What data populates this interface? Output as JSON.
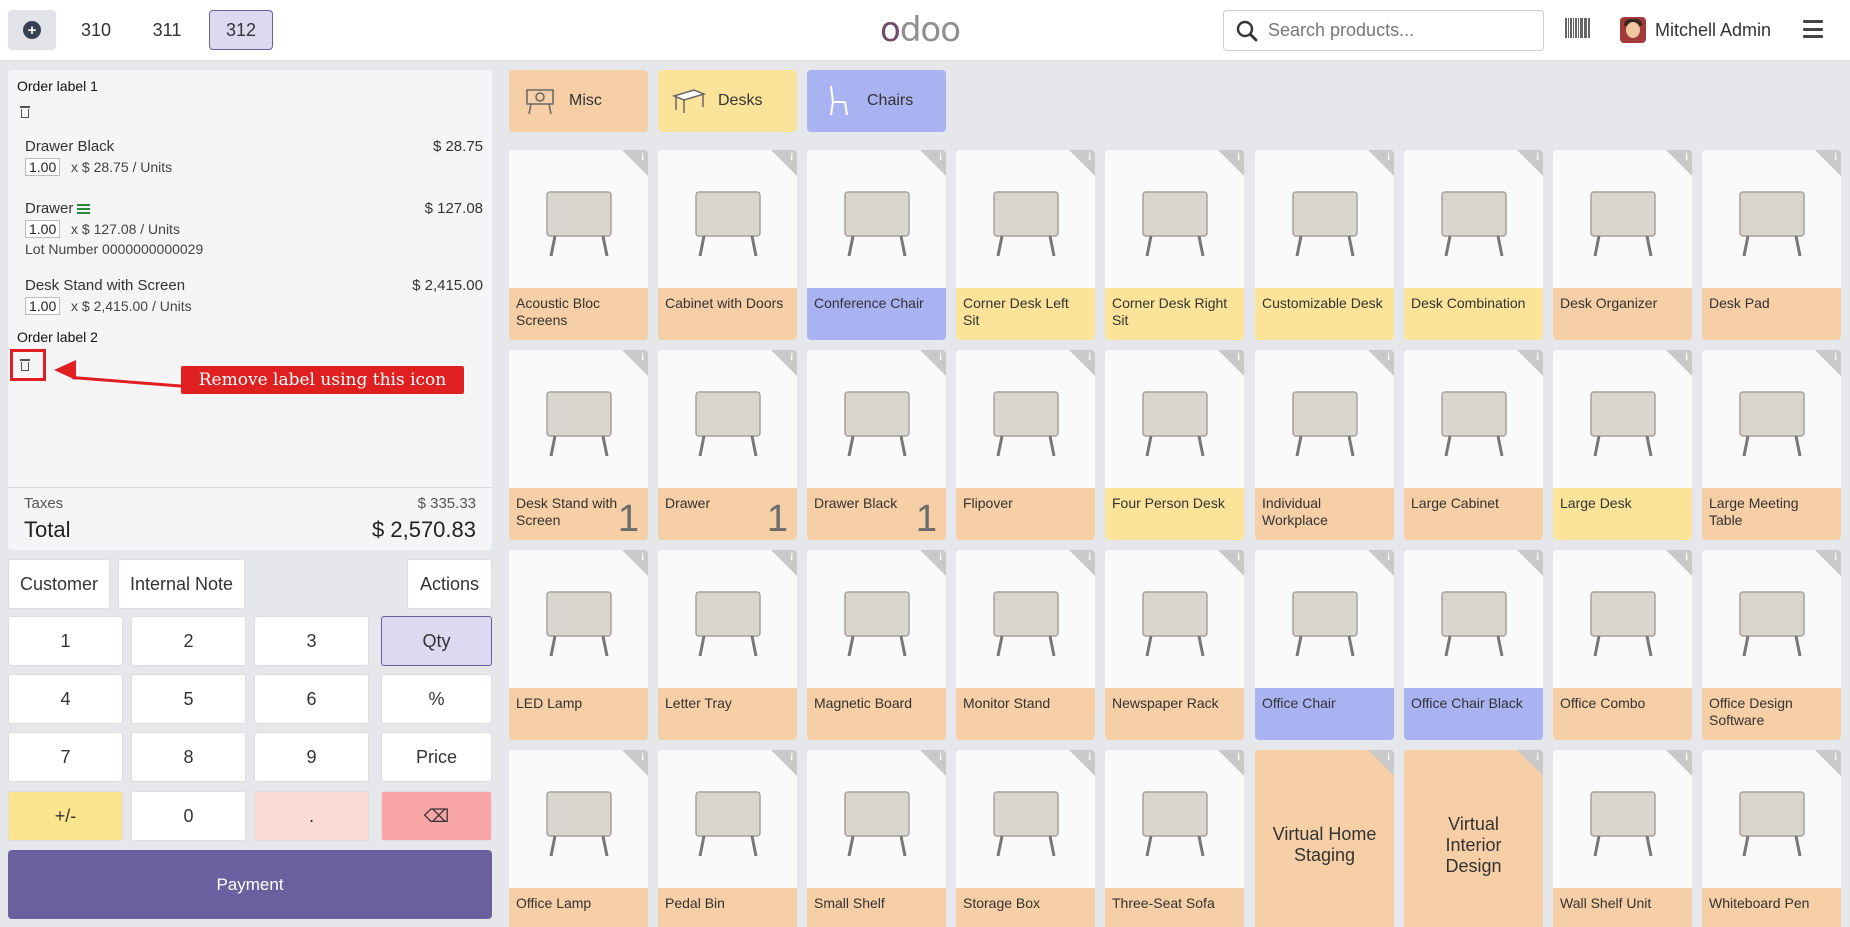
{
  "topbar": {
    "order_tabs": [
      "310",
      "311",
      "312"
    ],
    "active_tab": "312",
    "logo": "odoo",
    "search_placeholder": "Search products...",
    "user_name": "Mitchell Admin"
  },
  "order": {
    "label1": "Order label 1",
    "label2": "Order label 2",
    "lines": [
      {
        "name": "Drawer Black",
        "price": "$ 28.75",
        "qty": "1.00",
        "unit": "x $ 28.75 / Units"
      },
      {
        "name": "Drawer",
        "price": "$ 127.08",
        "qty": "1.00",
        "unit": "x $ 127.08 / Units",
        "lot": "Lot Number 0000000000029"
      },
      {
        "name": "Desk Stand with Screen",
        "price": "$ 2,415.00",
        "qty": "1.00",
        "unit": "x $ 2,415.00 / Units"
      }
    ],
    "taxes_label": "Taxes",
    "taxes_value": "$ 335.33",
    "total_label": "Total",
    "total_value": "$ 2,570.83"
  },
  "annotation": {
    "callout": "Remove label using this icon",
    "color": "#e02020"
  },
  "controls": {
    "customer": "Customer",
    "internal_note": "Internal Note",
    "actions": "Actions",
    "keys": [
      "1",
      "2",
      "3",
      "Qty",
      "4",
      "5",
      "6",
      "%",
      "7",
      "8",
      "9",
      "Price",
      "+/-",
      "0",
      ".",
      "⌫"
    ],
    "payment": "Payment"
  },
  "categories": [
    {
      "label": "Misc",
      "color": "#f6cfa6"
    },
    {
      "label": "Desks",
      "color": "#fbe49a"
    },
    {
      "label": "Chairs",
      "color": "#a9b3f2"
    }
  ],
  "products": [
    {
      "name": "Acoustic Bloc Screens",
      "cat": "misc"
    },
    {
      "name": "Cabinet with Doors",
      "cat": "misc"
    },
    {
      "name": "Conference Chair",
      "cat": "chair"
    },
    {
      "name": "Corner Desk Left Sit",
      "cat": "desk"
    },
    {
      "name": "Corner Desk Right Sit",
      "cat": "desk"
    },
    {
      "name": "Customizable Desk",
      "cat": "desk"
    },
    {
      "name": "Desk Combination",
      "cat": "desk"
    },
    {
      "name": "Desk Organizer",
      "cat": "misc"
    },
    {
      "name": "Desk Pad",
      "cat": "misc"
    },
    {
      "name": "Desk Stand with Screen",
      "cat": "misc",
      "qty": "1"
    },
    {
      "name": "Drawer",
      "cat": "misc",
      "qty": "1"
    },
    {
      "name": "Drawer Black",
      "cat": "misc",
      "qty": "1"
    },
    {
      "name": "Flipover",
      "cat": "misc"
    },
    {
      "name": "Four Person Desk",
      "cat": "desk"
    },
    {
      "name": "Individual Workplace",
      "cat": "misc"
    },
    {
      "name": "Large Cabinet",
      "cat": "misc"
    },
    {
      "name": "Large Desk",
      "cat": "desk"
    },
    {
      "name": "Large Meeting Table",
      "cat": "misc"
    },
    {
      "name": "LED Lamp",
      "cat": "misc"
    },
    {
      "name": "Letter Tray",
      "cat": "misc"
    },
    {
      "name": "Magnetic Board",
      "cat": "misc"
    },
    {
      "name": "Monitor Stand",
      "cat": "misc"
    },
    {
      "name": "Newspaper Rack",
      "cat": "misc"
    },
    {
      "name": "Office Chair",
      "cat": "chair"
    },
    {
      "name": "Office Chair Black",
      "cat": "chair"
    },
    {
      "name": "Office Combo",
      "cat": "misc"
    },
    {
      "name": "Office Design Software",
      "cat": "misc"
    },
    {
      "name": "Office Lamp",
      "cat": "misc"
    },
    {
      "name": "Pedal Bin",
      "cat": "misc"
    },
    {
      "name": "Small Shelf",
      "cat": "misc"
    },
    {
      "name": "Storage Box",
      "cat": "misc"
    },
    {
      "name": "Three-Seat Sofa",
      "cat": "misc"
    },
    {
      "name": "Virtual Home Staging",
      "cat": "misc",
      "text_only": true
    },
    {
      "name": "Virtual Interior Design",
      "cat": "misc",
      "text_only": true
    },
    {
      "name": "Wall Shelf Unit",
      "cat": "misc"
    },
    {
      "name": "Whiteboard Pen",
      "cat": "misc"
    }
  ]
}
